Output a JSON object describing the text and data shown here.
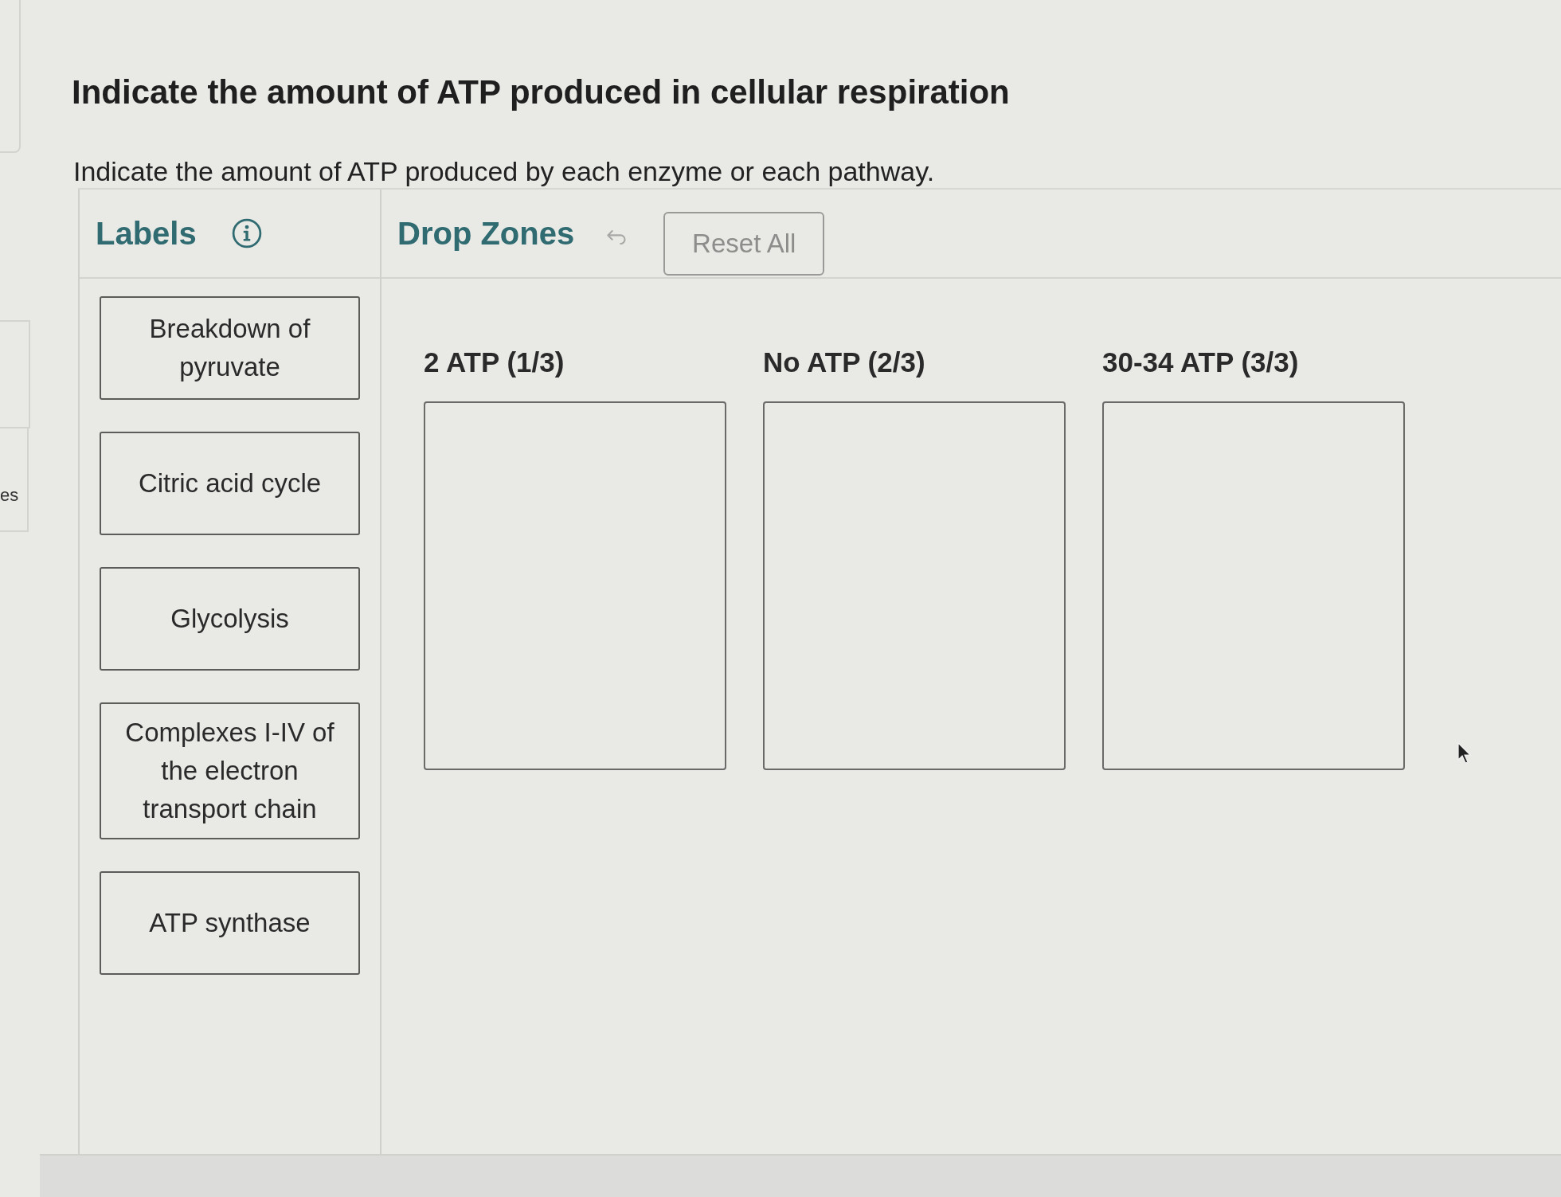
{
  "side_tab": {
    "label": "es"
  },
  "title": "Indicate the amount of ATP produced in cellular respiration",
  "instructions": "Indicate the amount of ATP produced by each enzyme or each pathway.",
  "labels_panel": {
    "heading": "Labels",
    "labels": [
      "Breakdown of pyruvate",
      "Citric acid cycle",
      "Glycolysis",
      "Complexes I-IV of the electron transport chain",
      "ATP synthase"
    ]
  },
  "drop_zones_panel": {
    "heading": "Drop Zones",
    "reset_button": {
      "label": "Reset All",
      "disabled": true
    },
    "zones": [
      {
        "heading": "2 ATP (1/3)"
      },
      {
        "heading": "No ATP (2/3)"
      },
      {
        "heading": "30-34 ATP (3/3)"
      }
    ]
  }
}
